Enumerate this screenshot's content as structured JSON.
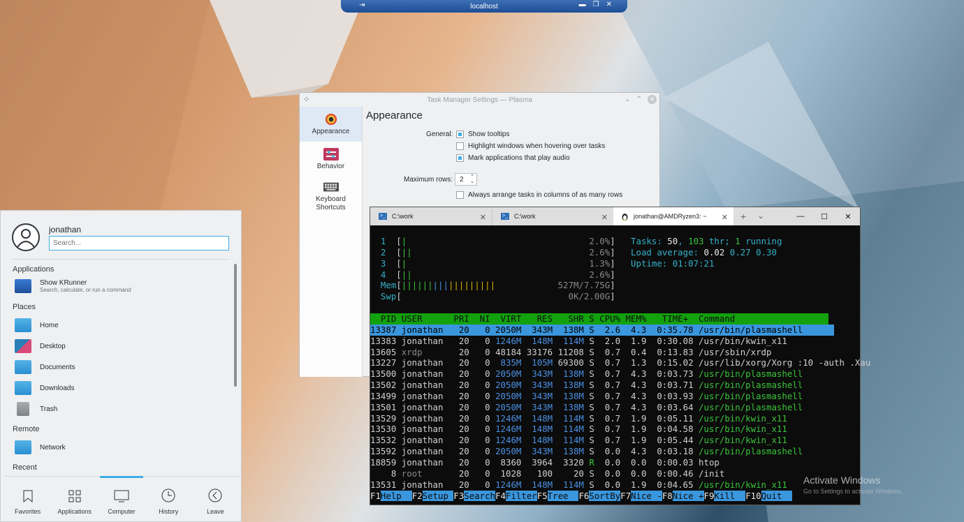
{
  "rdp": {
    "title": "localhost"
  },
  "settings": {
    "title": "Task Manager Settings — Plasma",
    "sidebar": [
      {
        "label": "Appearance"
      },
      {
        "label": "Behavior"
      },
      {
        "label": "Keyboard\nShortcuts"
      }
    ],
    "heading": "Appearance",
    "general_label": "General:",
    "opts": [
      "Show tooltips",
      "Highlight windows when hovering over tasks",
      "Mark applications that play audio"
    ],
    "max_rows_label": "Maximum rows:",
    "max_rows_value": "2",
    "arrange_label": "Always arrange tasks in columns of as many rows"
  },
  "launcher": {
    "username": "jonathan",
    "search_placeholder": "Search...",
    "sections": {
      "applications": "Applications",
      "places": "Places",
      "remote": "Remote",
      "recent": "Recent"
    },
    "krunner": {
      "title": "Show KRunner",
      "desc": "Search, calculate, or run a command"
    },
    "places": [
      "Home",
      "Desktop",
      "Documents",
      "Downloads",
      "Trash"
    ],
    "remote": [
      "Network"
    ],
    "tabs": [
      "Favorites",
      "Applications",
      "Computer",
      "History",
      "Leave"
    ]
  },
  "terminal": {
    "tabs": [
      "C:\\work",
      "C:\\work",
      "jonathan@AMDRyzen3: ~"
    ],
    "cpu": [
      {
        "n": "1",
        "bar": "|",
        "pct": "2.0%"
      },
      {
        "n": "2",
        "bar": "||",
        "pct": "2.6%"
      },
      {
        "n": "3",
        "bar": "|",
        "pct": "1.3%"
      },
      {
        "n": "4",
        "bar": "||",
        "pct": "2.6%"
      }
    ],
    "mem": {
      "label": "Mem",
      "bar": "||||||||||||||||||",
      "val": "527M/7.75G"
    },
    "swp": {
      "label": "Swp",
      "val": "0K/2.00G"
    },
    "tasks_label": "Tasks: ",
    "tasks": "50",
    "thr": "103",
    "thr_label": " thr; ",
    "running": "1",
    "running_label": " running",
    "load_label": "Load average: ",
    "load": [
      "0.02",
      "0.27",
      "0.30"
    ],
    "uptime_label": "Uptime: ",
    "uptime": "01:07:21",
    "header": "  PID USER      PRI  NI  VIRT   RES   SHR S CPU% MEM%   TIME+  Command                  ",
    "procs": [
      {
        "pid": "13387",
        "user": "jonathan",
        "pri": "20",
        "ni": "0",
        "virt": "2050M",
        "res": "343M",
        "shr": "138M",
        "s": "S",
        "cpu": "2.6",
        "mem": "4.3",
        "time": "0:35.78",
        "cmd": "/usr/bin/plasmashell"
      },
      {
        "pid": "13383",
        "user": "jonathan",
        "pri": "20",
        "ni": "0",
        "virt": "1246M",
        "res": "148M",
        "shr": "114M",
        "s": "S",
        "cpu": "2.0",
        "mem": "1.9",
        "time": "0:30.08",
        "cmd": "/usr/bin/kwin_x11"
      },
      {
        "pid": "13605",
        "user": "xrdp",
        "pri": "20",
        "ni": "0",
        "virt": "48184",
        "res": "33176",
        "shr": "11208",
        "s": "S",
        "cpu": "0.7",
        "mem": "0.4",
        "time": "0:13.83",
        "cmd": "/usr/sbin/xrdp"
      },
      {
        "pid": "13227",
        "user": "jonathan",
        "pri": "20",
        "ni": "0",
        "virt": "835M",
        "res": "105M",
        "shr": "69300",
        "s": "S",
        "cpu": "0.7",
        "mem": "1.3",
        "time": "0:15.02",
        "cmd": "/usr/lib/xorg/Xorg :10 -auth .Xau"
      },
      {
        "pid": "13500",
        "user": "jonathan",
        "pri": "20",
        "ni": "0",
        "virt": "2050M",
        "res": "343M",
        "shr": "138M",
        "s": "S",
        "cpu": "0.7",
        "mem": "4.3",
        "time": "0:03.73",
        "cmd": "/usr/bin/plasmashell"
      },
      {
        "pid": "13502",
        "user": "jonathan",
        "pri": "20",
        "ni": "0",
        "virt": "2050M",
        "res": "343M",
        "shr": "138M",
        "s": "S",
        "cpu": "0.7",
        "mem": "4.3",
        "time": "0:03.71",
        "cmd": "/usr/bin/plasmashell"
      },
      {
        "pid": "13499",
        "user": "jonathan",
        "pri": "20",
        "ni": "0",
        "virt": "2050M",
        "res": "343M",
        "shr": "138M",
        "s": "S",
        "cpu": "0.7",
        "mem": "4.3",
        "time": "0:03.93",
        "cmd": "/usr/bin/plasmashell"
      },
      {
        "pid": "13501",
        "user": "jonathan",
        "pri": "20",
        "ni": "0",
        "virt": "2050M",
        "res": "343M",
        "shr": "138M",
        "s": "S",
        "cpu": "0.7",
        "mem": "4.3",
        "time": "0:03.64",
        "cmd": "/usr/bin/plasmashell"
      },
      {
        "pid": "13529",
        "user": "jonathan",
        "pri": "20",
        "ni": "0",
        "virt": "1246M",
        "res": "148M",
        "shr": "114M",
        "s": "S",
        "cpu": "0.7",
        "mem": "1.9",
        "time": "0:05.11",
        "cmd": "/usr/bin/kwin_x11"
      },
      {
        "pid": "13530",
        "user": "jonathan",
        "pri": "20",
        "ni": "0",
        "virt": "1246M",
        "res": "148M",
        "shr": "114M",
        "s": "S",
        "cpu": "0.7",
        "mem": "1.9",
        "time": "0:04.58",
        "cmd": "/usr/bin/kwin_x11"
      },
      {
        "pid": "13532",
        "user": "jonathan",
        "pri": "20",
        "ni": "0",
        "virt": "1246M",
        "res": "148M",
        "shr": "114M",
        "s": "S",
        "cpu": "0.7",
        "mem": "1.9",
        "time": "0:05.44",
        "cmd": "/usr/bin/kwin_x11"
      },
      {
        "pid": "13592",
        "user": "jonathan",
        "pri": "20",
        "ni": "0",
        "virt": "2050M",
        "res": "343M",
        "shr": "138M",
        "s": "S",
        "cpu": "0.0",
        "mem": "4.3",
        "time": "0:03.18",
        "cmd": "/usr/bin/plasmashell"
      },
      {
        "pid": "18859",
        "user": "jonathan",
        "pri": "20",
        "ni": "0",
        "virt": "8360",
        "res": "3964",
        "shr": "3320",
        "s": "R",
        "cpu": "0.0",
        "mem": "0.0",
        "time": "0:00.03",
        "cmd": "htop"
      },
      {
        "pid": "8",
        "user": "root",
        "pri": "20",
        "ni": "0",
        "virt": "1028",
        "res": "100",
        "shr": "20",
        "s": "S",
        "cpu": "0.0",
        "mem": "0.0",
        "time": "0:00.46",
        "cmd": "/init"
      },
      {
        "pid": "13531",
        "user": "jonathan",
        "pri": "20",
        "ni": "0",
        "virt": "1246M",
        "res": "148M",
        "shr": "114M",
        "s": "S",
        "cpu": "0.0",
        "mem": "1.9",
        "time": "0:04.65",
        "cmd": "/usr/bin/kwin_x11"
      }
    ],
    "fkeys": [
      {
        "k": "F1",
        "l": "Help  "
      },
      {
        "k": "F2",
        "l": "Setup "
      },
      {
        "k": "F3",
        "l": "Search"
      },
      {
        "k": "F4",
        "l": "Filter"
      },
      {
        "k": "F5",
        "l": "Tree  "
      },
      {
        "k": "F6",
        "l": "SortBy"
      },
      {
        "k": "F7",
        "l": "Nice -"
      },
      {
        "k": "F8",
        "l": "Nice +"
      },
      {
        "k": "F9",
        "l": "Kill  "
      },
      {
        "k": "F10",
        "l": "Quit  "
      }
    ]
  },
  "watermark": {
    "line1": "Activate Windows",
    "line2": "Go to Settings to activate Windows."
  }
}
